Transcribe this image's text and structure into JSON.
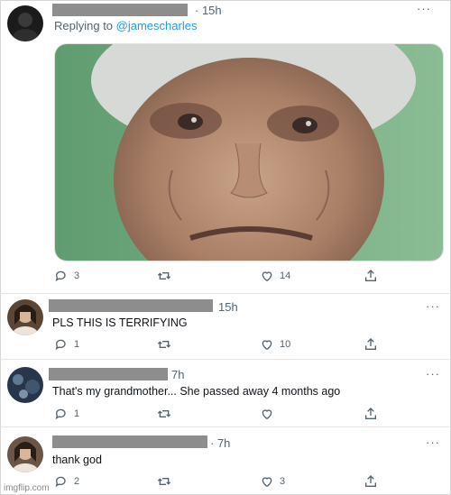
{
  "op_tweet": {
    "time": "· 15h",
    "replying_prefix": "Replying to ",
    "replying_handle": "@jamescharles",
    "more": "···",
    "stats": {
      "replies": "3",
      "retweets": "",
      "likes": "14"
    }
  },
  "replies": [
    {
      "time": "15h",
      "text": "PLS THIS IS TERRIFYING",
      "more": "···",
      "stats": {
        "replies": "1",
        "retweets": "",
        "likes": "10"
      }
    },
    {
      "time": "7h",
      "text": "That's my grandmother... She passed away 4 months ago",
      "more": "···",
      "stats": {
        "replies": "1",
        "retweets": "",
        "likes": ""
      }
    },
    {
      "time": "· 7h",
      "text": "thank god",
      "more": "···",
      "stats": {
        "replies": "2",
        "retweets": "",
        "likes": "3"
      }
    }
  ],
  "watermark": "imgflip.com",
  "colors": {
    "link": "#1d9bf0",
    "muted": "#536471",
    "redaction": "#8d8d8d"
  },
  "icons": [
    "reply-icon",
    "retweet-icon",
    "like-icon",
    "share-icon",
    "more-icon"
  ]
}
